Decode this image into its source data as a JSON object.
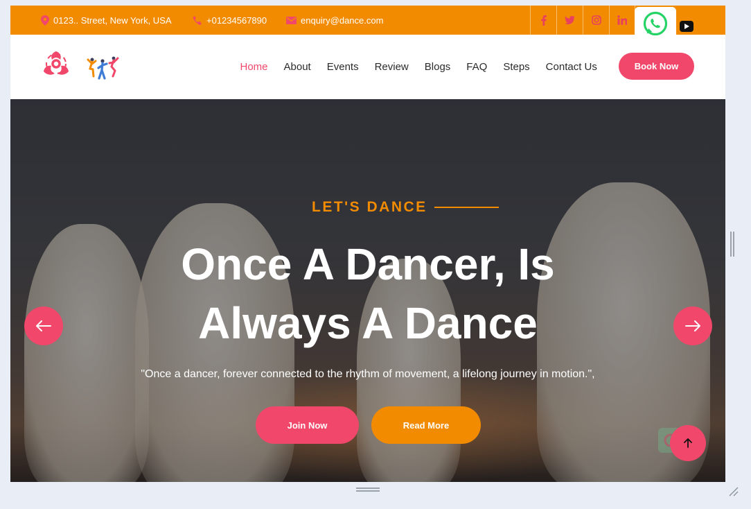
{
  "topbar": {
    "address": "0123.. Street, New York, USA",
    "phone": "+01234567890",
    "email": "enquiry@dance.com",
    "socials": [
      "f",
      "t",
      "ig",
      "in"
    ]
  },
  "nav": {
    "items": [
      {
        "label": "Home",
        "active": true
      },
      {
        "label": "About"
      },
      {
        "label": "Events"
      },
      {
        "label": "Review"
      },
      {
        "label": "Blogs"
      },
      {
        "label": "FAQ"
      },
      {
        "label": "Steps"
      },
      {
        "label": "Contact Us"
      }
    ],
    "cta": "Book Now"
  },
  "hero": {
    "kicker": "LET'S DANCE",
    "headline_line1": "Once A Dancer, Is",
    "headline_line2": "Always A Dance",
    "tagline": "\"Once a dancer, forever connected to the rhythm of movement, a lifelong journey in motion.\",",
    "join_label": "Join Now",
    "more_label": "Read More"
  },
  "colors": {
    "primary_pink": "#f0476a",
    "accent_orange": "#f28b00"
  }
}
